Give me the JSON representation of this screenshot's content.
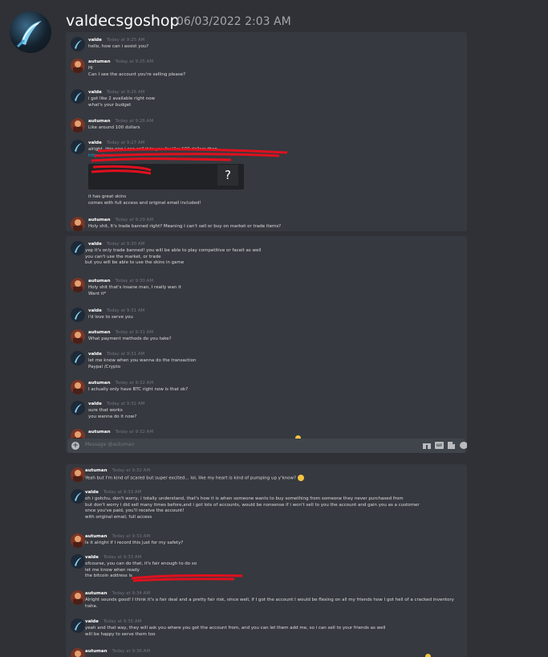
{
  "header": {
    "name": "valdecsgoshop",
    "date": "06/03/2022 2:03 AM"
  },
  "colors": {
    "background": "#2f3136",
    "panel": "#36393f",
    "link": "#00aff4",
    "redaction": "#e0101e"
  },
  "panel1": {
    "messages": [
      {
        "author": "valde",
        "time": "Today at 9:25 AM",
        "lines": [
          "hello, how can i assist you?"
        ]
      },
      {
        "author": "autuman",
        "time": "Today at 9:25 AM",
        "lines": [
          "Hi",
          "Can I see the account you're selling please?"
        ]
      },
      {
        "author": "valde",
        "time": "Today at 9:26 AM",
        "lines": [
          "i got like 2 available right now",
          "what's your budget"
        ]
      },
      {
        "author": "autuman",
        "time": "Today at 9:26 AM",
        "lines": [
          "Like around 100 dollars"
        ]
      },
      {
        "author": "valde",
        "time": "Today at 9:27 AM",
        "lines": [
          "alright, this one i can sell it to you for like 100 dollars then",
          "https://stea",
          "",
          "",
          "",
          "",
          "it has great skins",
          "comes with full access and original email included!"
        ]
      },
      {
        "author": "autuman",
        "time": "Today at 9:29 AM",
        "lines": [
          "Holy shit, It's trade banned right? Meaning I can't sell or buy on market or trade items?"
        ]
      }
    ],
    "embed_icon": "?"
  },
  "panel2": {
    "messages": [
      {
        "author": "valde",
        "time": "Today at 9:30 AM",
        "lines": [
          "yep it's only trade banned! you will be able to play competitive or faceit as well",
          "you can't use the market, or trade",
          "but you will be able to use the skins in game"
        ]
      },
      {
        "author": "autuman",
        "time": "Today at 9:30 AM",
        "lines": [
          "Holy shit that's insane man, I really wan it",
          "Want it*"
        ]
      },
      {
        "author": "valde",
        "time": "Today at 9:31 AM",
        "lines": [
          "i'd love to serve you"
        ]
      },
      {
        "author": "autuman",
        "time": "Today at 9:31 AM",
        "lines": [
          "What payment methods do you take?"
        ]
      },
      {
        "author": "valde",
        "time": "Today at 9:31 AM",
        "lines": [
          "let me know when you wanna do the transaction",
          "Paypal /Crypto"
        ]
      },
      {
        "author": "autuman",
        "time": "Today at 9:32 AM",
        "lines": [
          "I actually only have BTC right now is that ok?"
        ]
      },
      {
        "author": "valde",
        "time": "Today at 9:32 AM",
        "lines": [
          "sure that works",
          "you wanna do it now?"
        ]
      },
      {
        "author": "autuman",
        "time": "Today at 9:32 AM",
        "lines": []
      }
    ],
    "input_placeholder": "Message @autuman"
  },
  "panel3": {
    "messages": [
      {
        "author": "autuman",
        "time": "Today at 9:32 AM",
        "lines": [
          "Yeah but I'm kind of scared but super excited... lol, like my heart is kind of pumping up y'know?"
        ]
      },
      {
        "author": "valde",
        "time": "Today at 9:33 AM",
        "lines": [
          "oh i gotchu, don't worry, i totally understand, that's how it is when someone wants to buy something from someone they never purchased from",
          "but don't worry i did sell many times before,and i got lots of accounts, would be nonsense if i won't sell to you the account and gain you as a customer",
          "once you've paid, you'll receive the account!",
          "with original email, full access"
        ]
      },
      {
        "author": "autuman",
        "time": "Today at 9:33 AM",
        "lines": [
          "Is it alright if I record this just for my safety?"
        ]
      },
      {
        "author": "valde",
        "time": "Today at 9:33 AM",
        "lines": [
          "ofcourse, you can do that, it's fair enough to do so",
          "let me know when ready",
          "the bitcoin address is"
        ]
      },
      {
        "author": "autuman",
        "time": "Today at 9:34 AM",
        "lines": [
          "Alright sounds good! I think it's a fair deal and a pretty fair risk, since well, if I got the account I would be flexing on all my friends how I got hell of a cracked inventory",
          "haha."
        ]
      },
      {
        "author": "valde",
        "time": "Today at 9:35 AM",
        "lines": [
          "yeah and that way, they will ask you where you got the account from, and you can let them add me, so i can sell to your friends as well",
          "will be happy to serve them too"
        ]
      },
      {
        "author": "autuman",
        "time": "Today at 9:36 AM",
        "lines": []
      }
    ]
  }
}
